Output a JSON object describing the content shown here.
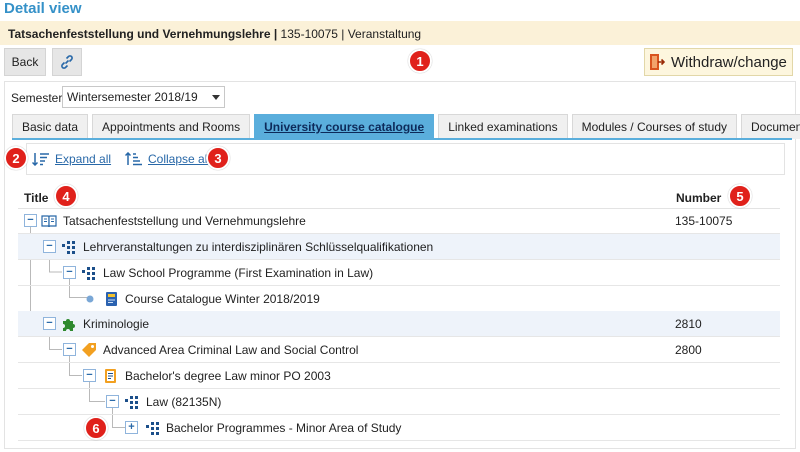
{
  "page": {
    "title": "Detail view"
  },
  "header": {
    "course_title": "Tatsachenfeststellung und Vernehmungslehre",
    "separator": "|",
    "meta": "135-10075 | Veranstaltung"
  },
  "toolbar": {
    "back_label": "Back",
    "withdraw_label": "Withdraw/change"
  },
  "semester": {
    "label": "Semester",
    "value": "Wintersemester 2018/19"
  },
  "tabs": [
    {
      "label": "Basic data"
    },
    {
      "label": "Appointments and Rooms"
    },
    {
      "label": "University course catalogue"
    },
    {
      "label": "Linked examinations"
    },
    {
      "label": "Modules / Courses of study"
    },
    {
      "label": "Documents"
    }
  ],
  "actions": {
    "expand_label": "Expand all",
    "collapse_label": "Collapse all"
  },
  "tree": {
    "col_title": "Title",
    "col_number": "Number",
    "rows": [
      {
        "label": "Tatsachenfeststellung und Vernehmungslehre",
        "number": "135-10075",
        "icon": "book-icon"
      },
      {
        "label": "Lehrveranstaltungen zu interdisziplinären Schlüsselqualifikationen",
        "number": "",
        "icon": "structure-icon"
      },
      {
        "label": "Law School Programme (First Examination in Law)",
        "number": "",
        "icon": "structure-icon"
      },
      {
        "label": "Course Catalogue Winter 2018/2019",
        "number": "",
        "icon": "catalog-icon"
      },
      {
        "label": "Kriminologie",
        "number": "2810",
        "icon": "puzzle-icon"
      },
      {
        "label": "Advanced Area Criminal Law and Social Control",
        "number": "2800",
        "icon": "tag-icon"
      },
      {
        "label": "Bachelor's degree Law minor PO 2003",
        "number": "",
        "icon": "degree-icon"
      },
      {
        "label": "Law (82135N)",
        "number": "",
        "icon": "structure-icon"
      },
      {
        "label": "Bachelor Programmes - Minor Area of Study",
        "number": "",
        "icon": "structure-icon"
      }
    ]
  },
  "badges": [
    "1",
    "2",
    "3",
    "4",
    "5",
    "6"
  ],
  "colors": {
    "accent": "#3591c8",
    "active_tab": "#5aaedc",
    "badge": "#e0211b",
    "header_bg": "#fbf1d8"
  }
}
